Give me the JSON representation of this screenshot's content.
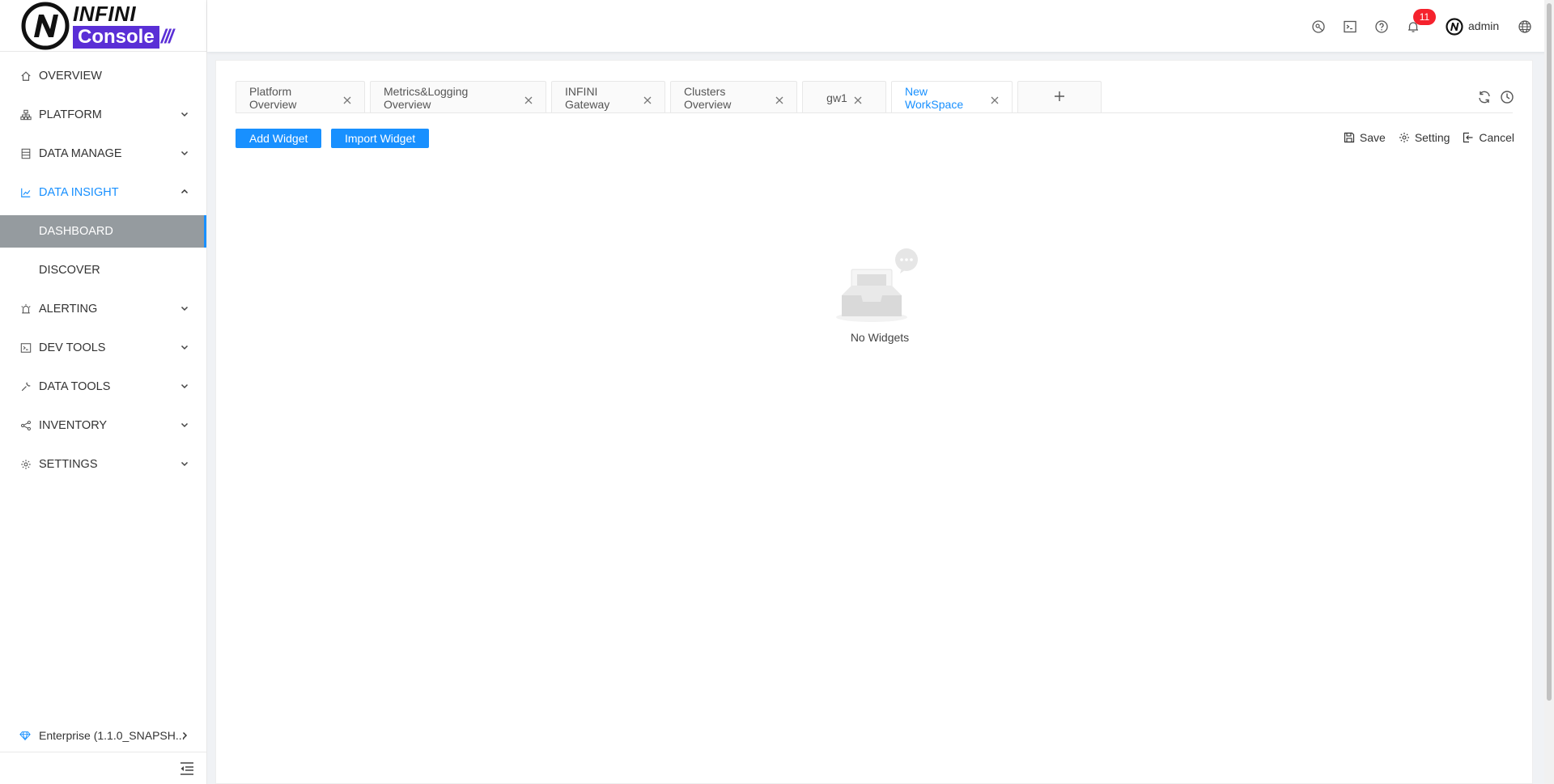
{
  "brand": {
    "top": "INFINI",
    "bottom": "Console",
    "accent": "#5a2fd6"
  },
  "sidebar": {
    "items": [
      {
        "label": "OVERVIEW",
        "icon": "home-icon"
      },
      {
        "label": "PLATFORM",
        "icon": "sitemap-icon"
      },
      {
        "label": "DATA MANAGE",
        "icon": "database-icon"
      },
      {
        "label": "DATA INSIGHT",
        "icon": "chart-icon"
      },
      {
        "label": "DASHBOARD"
      },
      {
        "label": "DISCOVER"
      },
      {
        "label": "ALERTING",
        "icon": "alarm-icon"
      },
      {
        "label": "DEV TOOLS",
        "icon": "terminal-icon"
      },
      {
        "label": "DATA TOOLS",
        "icon": "tool-icon"
      },
      {
        "label": "INVENTORY",
        "icon": "share-icon"
      },
      {
        "label": "SETTINGS",
        "icon": "gear-icon"
      }
    ],
    "version": "Enterprise (1.1.0_SNAPSH..."
  },
  "header": {
    "notifications": "11",
    "user": "admin"
  },
  "tabs": [
    {
      "label": "Platform Overview"
    },
    {
      "label": "Metrics&Logging Overview"
    },
    {
      "label": "INFINI Gateway"
    },
    {
      "label": "Clusters Overview"
    },
    {
      "label": "gw1"
    },
    {
      "label": "New WorkSpace"
    }
  ],
  "toolbar": {
    "add_widget": "Add Widget",
    "import_widget": "Import Widget",
    "save": "Save",
    "setting": "Setting",
    "cancel": "Cancel"
  },
  "empty_state": {
    "text": "No Widgets"
  },
  "colors": {
    "primary": "#1890ff",
    "selected_bg": "#959b9f",
    "badge": "#f5222d"
  }
}
